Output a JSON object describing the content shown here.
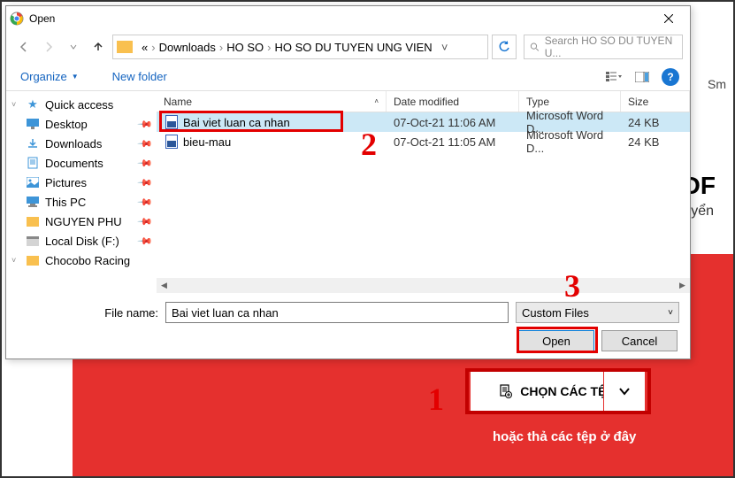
{
  "dialog": {
    "title": "Open",
    "breadcrumb": {
      "items": [
        "Downloads",
        "HO SO",
        "HO SO DU TUYEN UNG VIEN"
      ],
      "ellipsis": "«"
    },
    "search": {
      "placeholder": "Search HO SO DU TUYEN U..."
    },
    "toolbar": {
      "organize": "Organize",
      "newfolder": "New folder"
    },
    "sidebar": {
      "items": [
        {
          "label": "Quick access",
          "icon": "star"
        },
        {
          "label": "Desktop",
          "icon": "desktop",
          "pinned": true
        },
        {
          "label": "Downloads",
          "icon": "downloads",
          "pinned": true
        },
        {
          "label": "Documents",
          "icon": "documents",
          "pinned": true
        },
        {
          "label": "Pictures",
          "icon": "pictures",
          "pinned": true
        },
        {
          "label": "This PC",
          "icon": "thispc",
          "pinned": true
        },
        {
          "label": "NGUYEN PHU",
          "icon": "folder",
          "pinned": true
        },
        {
          "label": "Local Disk (F:)",
          "icon": "drive",
          "pinned": true
        },
        {
          "label": "Chocobo Racing",
          "icon": "folder",
          "pinned": true
        }
      ]
    },
    "columns": {
      "name": "Name",
      "date": "Date modified",
      "type": "Type",
      "size": "Size"
    },
    "files": [
      {
        "name": "Bai viet luan ca nhan",
        "date": "07-Oct-21 11:06 AM",
        "type": "Microsoft Word D...",
        "size": "24 KB",
        "selected": true
      },
      {
        "name": "bieu-mau",
        "date": "07-Oct-21 11:05 AM",
        "type": "Microsoft Word D...",
        "size": "24 KB",
        "selected": false
      }
    ],
    "filename_label": "File name:",
    "filename_value": "Bai viet luan ca nhan",
    "filetype": "Custom Files",
    "open_btn": "Open",
    "cancel_btn": "Cancel"
  },
  "background": {
    "heading_frag": "DF",
    "subheading_frag": "yển",
    "sm": "Sm",
    "choose_btn": "CHỌN CÁC TỆP",
    "drop_text": "hoặc thả các tệp ở đây"
  },
  "annotations": {
    "a1": "1",
    "a2": "2",
    "a3": "3"
  }
}
